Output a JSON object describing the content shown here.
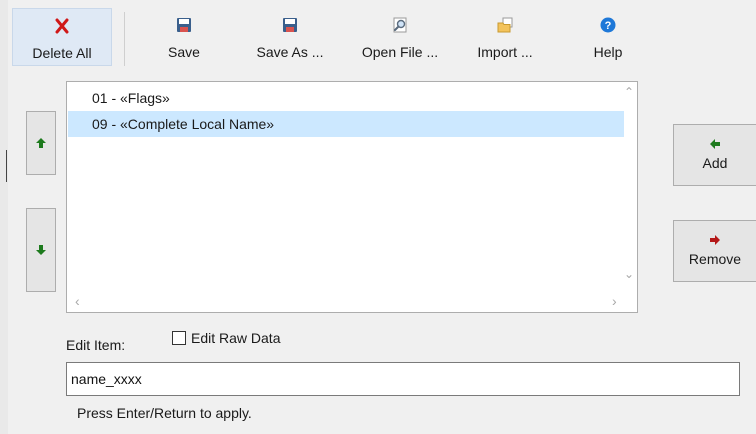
{
  "toolbar": {
    "delete_all": "Delete All",
    "save": "Save",
    "save_as": "Save As ...",
    "open_file": "Open File ...",
    "import": "Import ...",
    "help": "Help"
  },
  "list": {
    "items": [
      {
        "label": "01 - «Flags»",
        "selected": false
      },
      {
        "label": "09 - «Complete Local Name»",
        "selected": true
      }
    ]
  },
  "actions": {
    "add": "Add",
    "remove": "Remove"
  },
  "edit": {
    "label": "Edit Item:",
    "raw_data_label": "Edit Raw Data",
    "raw_data_checked": false,
    "value": "name_xxxx",
    "hint": "Press Enter/Return to apply."
  },
  "colors": {
    "selection": "#cce8ff",
    "delete_red": "#d01818",
    "arrow_green": "#1d7a1d",
    "arrow_red": "#b41818",
    "help_blue": "#1e78d8"
  }
}
